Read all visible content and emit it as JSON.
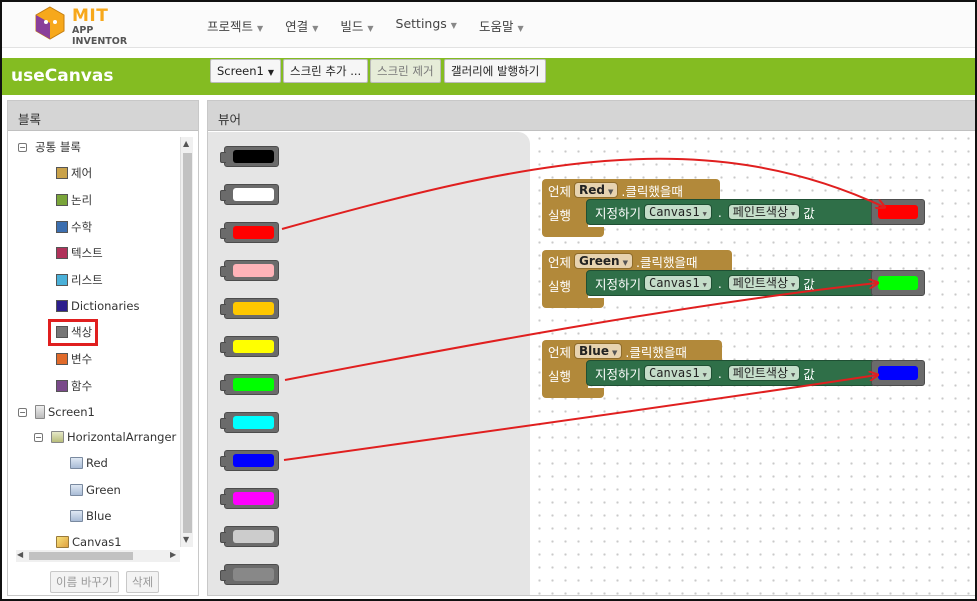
{
  "brand": {
    "name": "MIT",
    "sub": "APP INVENTOR"
  },
  "menu": [
    {
      "label": "프로젝트"
    },
    {
      "label": "연결"
    },
    {
      "label": "빌드"
    },
    {
      "label": "Settings"
    },
    {
      "label": "도움말"
    }
  ],
  "project": {
    "name": "useCanvas",
    "screen_select": "Screen1",
    "add_screen": "스크린 추가 ...",
    "remove_screen": "스크린 제거",
    "publish": "갤러리에 발행하기"
  },
  "blocks_panel": {
    "title": "블록",
    "builtin_title": "공통 블록",
    "builtin": [
      {
        "label": "제어",
        "color": "#c9a24a"
      },
      {
        "label": "논리",
        "color": "#7aa53a"
      },
      {
        "label": "수학",
        "color": "#3c6fb0"
      },
      {
        "label": "텍스트",
        "color": "#b0325a"
      },
      {
        "label": "리스트",
        "color": "#4ab0d8"
      },
      {
        "label": "Dictionaries",
        "color": "#2c1e8c"
      },
      {
        "label": "색상",
        "color": "#777777"
      },
      {
        "label": "변수",
        "color": "#e06a2a"
      },
      {
        "label": "함수",
        "color": "#7a4a8a"
      }
    ],
    "screen": "Screen1",
    "arrangement": "HorizontalArranger",
    "buttons": [
      "Red",
      "Green",
      "Blue"
    ],
    "canvas": "Canvas1",
    "rename_button": "이름 바꾸기",
    "delete_button": "삭제"
  },
  "viewer": {
    "title": "뷰어",
    "color_blocks": [
      "#000000",
      "#ffffff",
      "#ff0000",
      "#ffb3b8",
      "#ffc800",
      "#ffff00",
      "#00ff00",
      "#00ffff",
      "#0000ff",
      "#ff00ff",
      "#cccccc",
      "#888888"
    ],
    "events": [
      {
        "when": "언제",
        "component": "Red",
        "event": ".클릭했을때",
        "do": "실행",
        "set": "지정하기",
        "target": "Canvas1",
        "dot": ".",
        "property": "페인트색상",
        "to": "값",
        "color": "#ff0000"
      },
      {
        "when": "언제",
        "component": "Green",
        "event": ".클릭했을때",
        "do": "실행",
        "set": "지정하기",
        "target": "Canvas1",
        "dot": ".",
        "property": "페인트색상",
        "to": "값",
        "color": "#00ff00"
      },
      {
        "when": "언제",
        "component": "Blue",
        "event": ".클릭했을때",
        "do": "실행",
        "set": "지정하기",
        "target": "Canvas1",
        "dot": ".",
        "property": "페인트색상",
        "to": "값",
        "color": "#0000ff"
      }
    ]
  },
  "annotation_color": "#e01f1f"
}
